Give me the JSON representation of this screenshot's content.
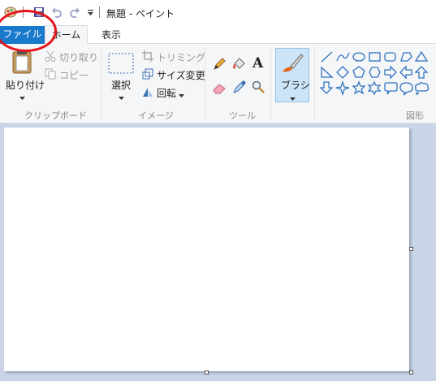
{
  "window": {
    "title": "無題 - ペイント"
  },
  "tabs": {
    "file": "ファイル",
    "home": "ホーム",
    "view": "表示"
  },
  "clipboard": {
    "paste": "貼り付け",
    "cut": "切り取り",
    "copy": "コピー",
    "group": "クリップボード"
  },
  "image": {
    "select": "選択",
    "crop": "トリミング",
    "resize": "サイズ変更",
    "rotate": "回転",
    "group": "イメージ"
  },
  "tools": {
    "group": "ツール"
  },
  "brushes": {
    "label": "ブラシ"
  },
  "shapes": {
    "group": "図形",
    "items": [
      "line-icon",
      "curve-icon",
      "oval-icon",
      "rectangle-icon",
      "rounded-rectangle-icon",
      "polygon-icon",
      "triangle-icon",
      "right-triangle-icon",
      "diamond-icon",
      "pentagon-icon",
      "hexagon-icon",
      "right-arrow-icon",
      "left-arrow-icon",
      "up-arrow-icon",
      "down-arrow-icon",
      "four-point-star-icon",
      "five-point-star-icon",
      "six-point-star-icon",
      "rounded-callout-icon",
      "oval-callout-icon",
      "cloud-callout-icon"
    ]
  },
  "colors": {
    "accent": "#1979ca",
    "annotation": "#e4161b",
    "canvas_bg": "#c9d5e7"
  }
}
